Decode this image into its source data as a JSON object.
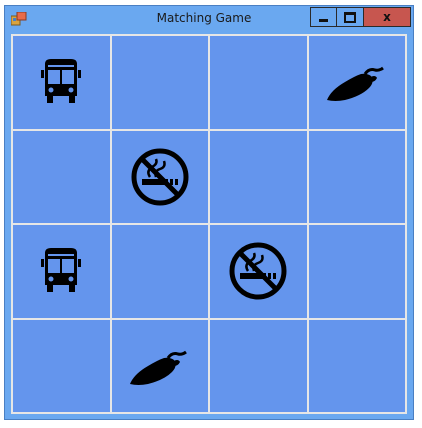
{
  "window": {
    "title": "Matching Game",
    "close_glyph": "x"
  },
  "colors": {
    "board": "#6495ed",
    "titlebar": "#6aa8f0",
    "close": "#c7564f",
    "gridline": "#e6e6e6",
    "icon": "#000000"
  },
  "board": {
    "rows": 4,
    "cols": 4,
    "cells": [
      {
        "icon": "bus-icon"
      },
      {
        "icon": ""
      },
      {
        "icon": ""
      },
      {
        "icon": "chili-pepper-icon"
      },
      {
        "icon": ""
      },
      {
        "icon": "no-smoking-icon"
      },
      {
        "icon": ""
      },
      {
        "icon": ""
      },
      {
        "icon": "bus-icon"
      },
      {
        "icon": ""
      },
      {
        "icon": "no-smoking-icon"
      },
      {
        "icon": ""
      },
      {
        "icon": ""
      },
      {
        "icon": "chili-pepper-icon"
      },
      {
        "icon": ""
      },
      {
        "icon": ""
      }
    ]
  }
}
